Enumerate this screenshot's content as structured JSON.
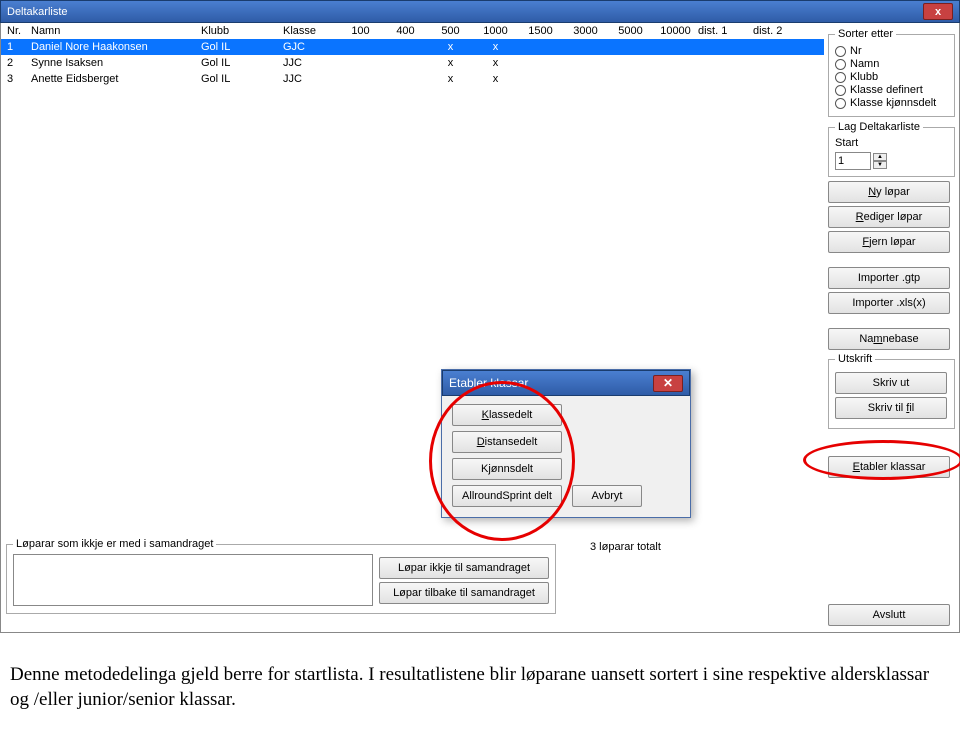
{
  "window": {
    "title": "Deltakarliste",
    "close": "x"
  },
  "table": {
    "headers": {
      "nr": "Nr.",
      "namn": "Namn",
      "klubb": "Klubb",
      "klasse": "Klasse",
      "d": [
        "100",
        "400",
        "500",
        "1000",
        "1500",
        "3000",
        "5000",
        "10000"
      ],
      "dist1": "dist. 1",
      "dist2": "dist. 2"
    },
    "rows": [
      {
        "nr": "1",
        "namn": "Daniel Nore Haakonsen",
        "klubb": "Gol IL",
        "klasse": "GJC",
        "marks": [
          "",
          "",
          "x",
          "x",
          "",
          "",
          "",
          ""
        ],
        "sel": true
      },
      {
        "nr": "2",
        "namn": "Synne Isaksen",
        "klubb": "Gol IL",
        "klasse": "JJC",
        "marks": [
          "",
          "",
          "x",
          "x",
          "",
          "",
          "",
          ""
        ],
        "sel": false
      },
      {
        "nr": "3",
        "namn": "Anette Eidsberget",
        "klubb": "Gol IL",
        "klasse": "JJC",
        "marks": [
          "",
          "",
          "x",
          "x",
          "",
          "",
          "",
          ""
        ],
        "sel": false
      }
    ]
  },
  "sort": {
    "legend": "Sorter etter",
    "options": [
      "Nr",
      "Namn",
      "Klubb",
      "Klasse definert",
      "Klasse kjønnsdelt"
    ]
  },
  "lag": {
    "legend": "Lag Deltakarliste",
    "start_label": "Start",
    "start_value": "1"
  },
  "buttons": {
    "ny": "Ny løpar",
    "rediger": "Rediger løpar",
    "fjern": "Fjern løpar",
    "imp_gtp": "Importer .gtp",
    "imp_xls": "Importer .xls(x)",
    "namnebase": "Namnebase"
  },
  "utskrift": {
    "legend": "Utskrift",
    "ut": "Skriv ut",
    "fil": "Skriv til fil"
  },
  "etabler": "Etabler klassar",
  "avslutt": "Avslutt",
  "bottom": {
    "legend": "Løparar som ikkje er med i samandraget",
    "b1": "Løpar ikkje til samandraget",
    "b2": "Løpar tilbake til samandraget",
    "total": "3 løparar totalt"
  },
  "dialog": {
    "title": "Etabler klassar",
    "b1": "Klassedelt",
    "b2": "Distansedelt",
    "b3": "Kjønnsdelt",
    "b4": "AllroundSprint delt",
    "cancel": "Avbryt"
  },
  "caption": "Denne metodedelinga gjeld berre for startlista. I resultatlistene blir løparane uansett sortert i sine respektive aldersklassar og /eller junior/senior klassar."
}
